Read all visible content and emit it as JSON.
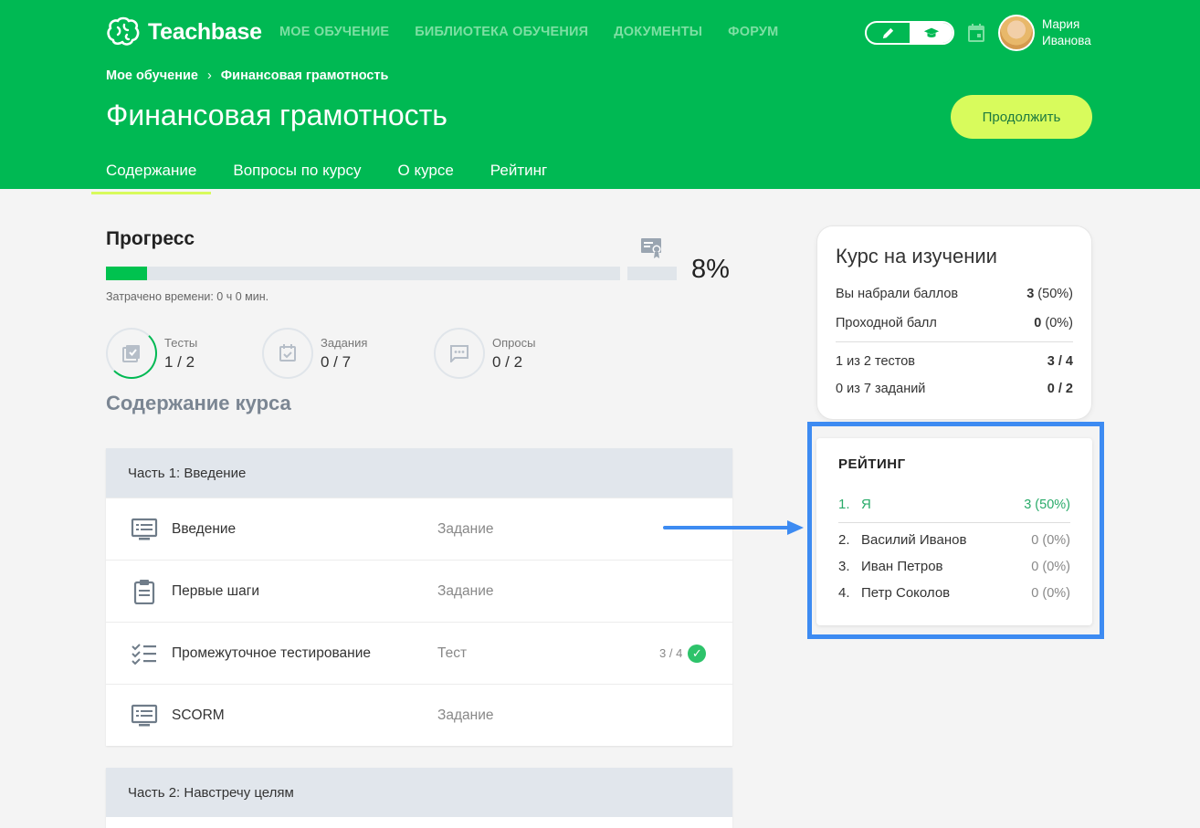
{
  "brand": {
    "name": "Teachbase",
    "primary": "#00b953",
    "accent": "#d8fb5c"
  },
  "topnav": [
    "МОЕ ОБУЧЕНИЕ",
    "БИБЛИОТЕКА ОБУЧЕНИЯ",
    "ДОКУМЕНТЫ",
    "ФОРУМ"
  ],
  "user": {
    "first": "Мария",
    "last": "Иванова"
  },
  "breadcrumb": {
    "root": "Мое обучение",
    "current": "Финансовая грамотность"
  },
  "page": {
    "title": "Финансовая грамотность",
    "continue_label": "Продолжить"
  },
  "tabs": [
    "Содержание",
    "Вопросы по курсу",
    "О курсе",
    "Рейтинг"
  ],
  "progress": {
    "title": "Прогресс",
    "percent": 8,
    "percent_label": "8%",
    "time_spent": "Затрачено времени: 0 ч 0 мин."
  },
  "stats": [
    {
      "label": "Тесты",
      "value": "1 / 2",
      "icon": "tests-icon"
    },
    {
      "label": "Задания",
      "value": "0 / 7",
      "icon": "tasks-icon"
    },
    {
      "label": "Опросы",
      "value": "0 / 2",
      "icon": "polls-icon"
    }
  ],
  "content_title": "Содержание курса",
  "parts": [
    {
      "title": "Часть 1: Введение",
      "lessons": [
        {
          "name": "Введение",
          "type": "Задание",
          "icon": "presentation-icon",
          "score": ""
        },
        {
          "name": "Первые шаги",
          "type": "Задание",
          "icon": "clipboard-icon",
          "score": ""
        },
        {
          "name": "Промежуточное тестирование",
          "type": "Тест",
          "icon": "checklist-icon",
          "score": "3 / 4"
        },
        {
          "name": "SCORM",
          "type": "Задание",
          "icon": "presentation-icon",
          "score": ""
        }
      ]
    },
    {
      "title": "Часть 2: Навстречу целям",
      "lessons": []
    }
  ],
  "course_card": {
    "title": "Курс на изучении",
    "rows": [
      {
        "label": "Вы набрали баллов",
        "value_bold": "3",
        "value_rest": " (50%)"
      },
      {
        "label": "Проходной балл",
        "value_bold": "0",
        "value_rest": " (0%)"
      },
      {
        "label": "1 из 2 тестов",
        "value_bold": "3 / 4",
        "value_rest": ""
      },
      {
        "label": "0 из 7 заданий",
        "value_bold": "0 / 2",
        "value_rest": ""
      }
    ]
  },
  "rating": {
    "title": "РЕЙТИНГ",
    "rows": [
      {
        "pos": "1.",
        "name": "Я",
        "score": "3 (50%)"
      },
      {
        "pos": "2.",
        "name": "Василий Иванов",
        "score": "0 (0%)"
      },
      {
        "pos": "3.",
        "name": "Иван Петров",
        "score": "0 (0%)"
      },
      {
        "pos": "4.",
        "name": "Петр Соколов",
        "score": "0 (0%)"
      }
    ]
  }
}
